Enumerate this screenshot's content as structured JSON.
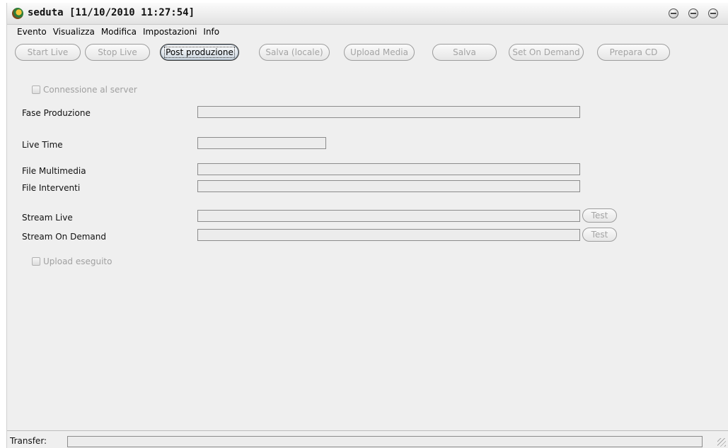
{
  "window": {
    "title": "seduta [11/10/2010 11:27:54]"
  },
  "menu": [
    {
      "label": "Evento"
    },
    {
      "label": "Visualizza"
    },
    {
      "label": "Modifica"
    },
    {
      "label": "Impostazioni"
    },
    {
      "label": "Info"
    }
  ],
  "toolbar": {
    "start_live": "Start Live",
    "stop_live": "Stop Live",
    "post_produzione": "Post produzione",
    "salva_locale": "Salva (locale)",
    "upload_media": "Upload Media",
    "salva": "Salva",
    "set_on_demand": "Set On Demand",
    "prepara_cd": "Prepara CD"
  },
  "form": {
    "connessione_label": "Connessione al server",
    "connessione_checked": false,
    "fase_produzione_label": "Fase Produzione",
    "fase_produzione_value": "",
    "live_time_label": "Live Time",
    "live_time_value": "",
    "file_multimedia_label": "File Multimedia",
    "file_multimedia_value": "",
    "file_interventi_label": "File Interventi",
    "file_interventi_value": "",
    "stream_live_label": "Stream Live",
    "stream_live_value": "",
    "stream_on_demand_label": "Stream On Demand",
    "stream_on_demand_value": "",
    "test_label": "Test",
    "upload_eseguito_label": "Upload eseguito",
    "upload_eseguito_checked": false
  },
  "status": {
    "transfer_label": "Transfer:",
    "transfer_progress": 0
  }
}
